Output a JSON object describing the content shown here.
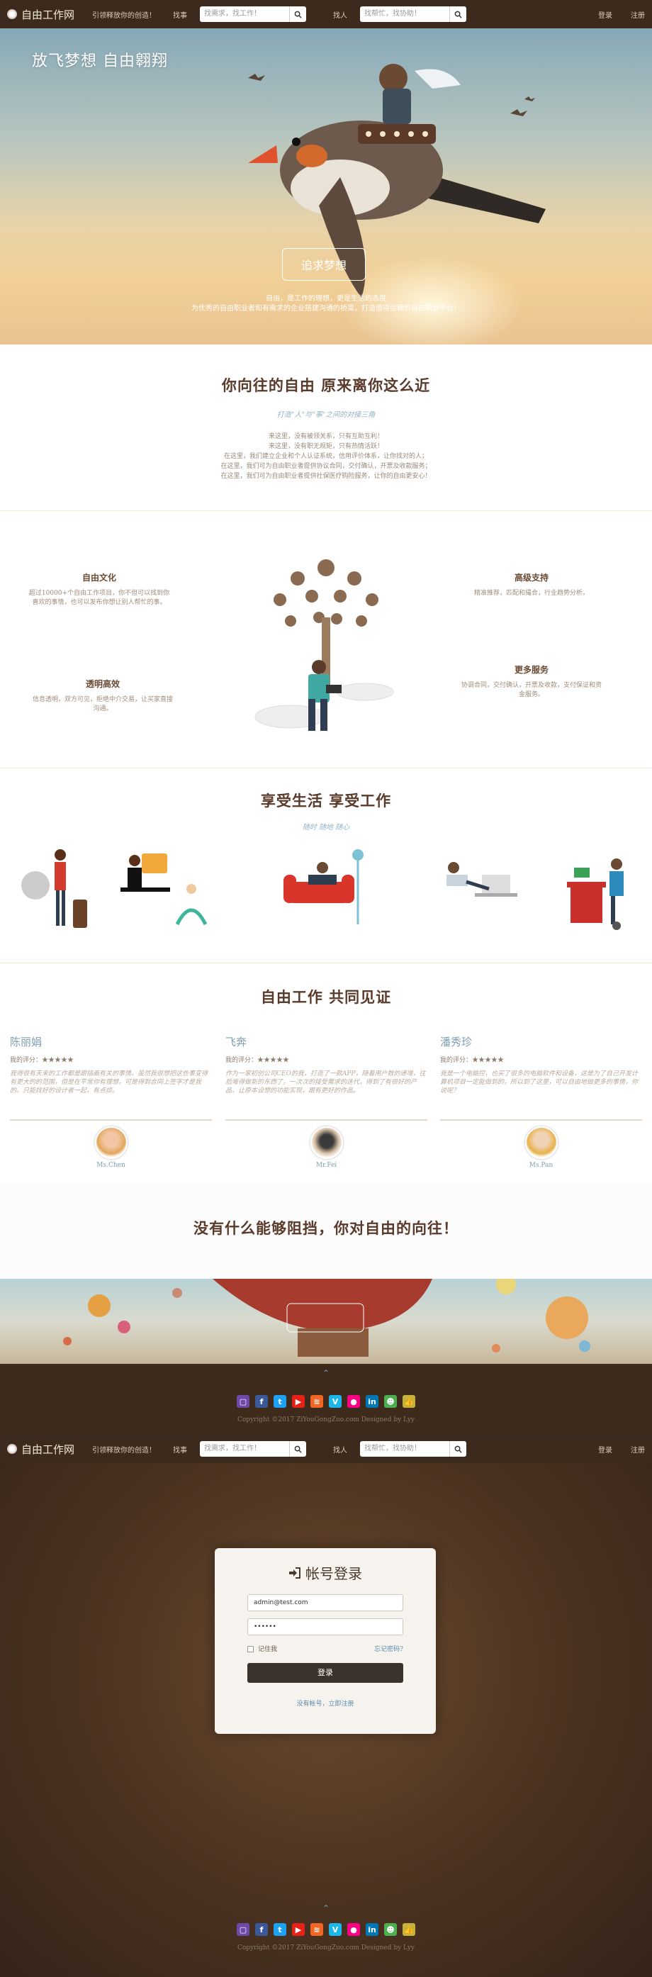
{
  "nav": {
    "brand": "自由工作网",
    "tagline": "引领释放你的创造！",
    "link_projects": "找事",
    "search_projects_placeholder": "找需求，找工作！",
    "link_people": "找人",
    "search_people_placeholder": "找帮忙，找协助！",
    "login": "登录",
    "register": "注册"
  },
  "hero": {
    "title": "放飞梦想 自由翱翔",
    "button": "追求梦想",
    "line1": "自由，是工作的理想，更是生活的态度",
    "line2": "为优秀的自由职业者和有需求的企业搭建沟通的桥梁，打造值得信赖的自由职业平台！"
  },
  "intro": {
    "title": "你向往的自由 原来离你这么近",
    "subtitle": "打造\"人\"与\"事\"之间的对接三角",
    "lines": [
      "来这里，没有被领关系，只有互助互利！",
      "来这里，没有职无规矩，只有热情活跃！",
      "在这里，我们建立企业和个人认证系统，信用评价体系，让你找对的人；",
      "在这里，我们可为自由职业者提供协议合同，交付确认，开票及收款服务；",
      "在这里，我们可为自由职业者提供社保医疗购险服务，让你的自由更安心！"
    ]
  },
  "features": {
    "culture": {
      "title": "自由文化",
      "text": "超过10000+个自由工作项目，你不但可以找到你喜欢的事情，也可以发布你想让别人帮忙的事。"
    },
    "transparent": {
      "title": "透明高效",
      "text": "信息透明，双方可见，拒绝中介交易，让买家直接沟通。"
    },
    "support": {
      "title": "高级支持",
      "text": "精准推荐，匹配和撮合，行业趋势分析。"
    },
    "services": {
      "title": "更多服务",
      "text": "协调合同，交付确认，开票及收款，支付保证和资金服务。"
    }
  },
  "life": {
    "title": "享受生活 享受工作",
    "subtitle": "随时 随地 随心"
  },
  "testimonials": {
    "title": "自由工作 共同见证",
    "items": [
      {
        "name": "陈丽娟",
        "rating": "我的评分：★★★★★",
        "body": "我得很有天来的工作都是跟插画有关的事情。虽然我很想把这些事变得有更大的的范围，但是在平常你有理想，可是得到合同上签字才是我的。只能找好的设计者一起，有点烦。",
        "user": "Ms.Chen"
      },
      {
        "name": "飞奔",
        "rating": "我的评分：★★★★★",
        "body": "作为一家初创公司CEO的我，打造了一款APP，随着用户数的递增，往后难得做新的东西了，一次次的接受需求的迭代，得到了有很好的产品，让原本设想的功能实现，跟有更好的作品。",
        "user": "Mr.Fei"
      },
      {
        "name": "潘秀珍",
        "rating": "我的评分：★★★★★",
        "body": "我是一个电脑控，也买了很多的电脑软件和设备，这是为了自己开发计算机项目一定能做到的，所以到了这里，可以自由地做更多的事情，你说呢？",
        "user": "Ms.Pan"
      }
    ]
  },
  "slogan": "没有什么能够阻挡，你对自由的向往！",
  "footer": {
    "copyright": "Copyright ©2017 ZiYouGongZuo.com Designed by Lyy"
  },
  "login": {
    "title": "帐号登录",
    "email": "admin@test.com",
    "password": "••••••",
    "remember": "记住我",
    "forgot": "忘记密码?",
    "submit": "登录",
    "no_account": "没有帐号，立即注册"
  },
  "colors": {
    "nav_bg": "#3c2a1c",
    "accent_blue": "#5a8cb0",
    "title_brown": "#5a3a2a"
  }
}
